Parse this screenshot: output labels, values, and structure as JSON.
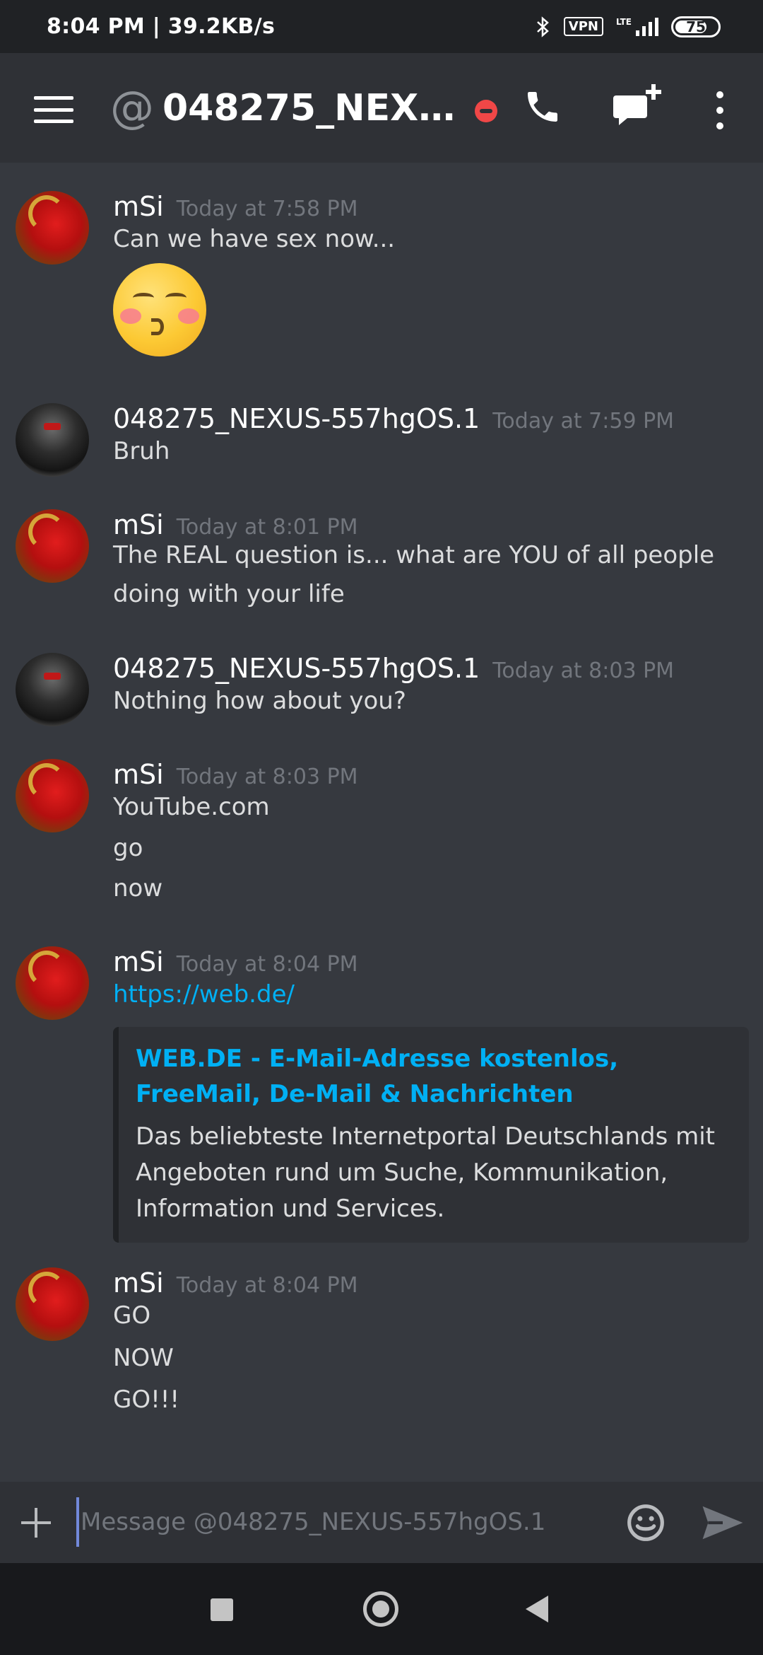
{
  "status_bar": {
    "time_speed": "8:04 PM | 39.2KB/s",
    "vpn_label": "VPN",
    "network_label": "LTE",
    "battery_level": "75",
    "battery_fraction": 0.75
  },
  "header": {
    "channel_prefix": "@",
    "channel_title": "048275_NEXUS...",
    "recipient_status": "do-not-disturb",
    "status_color": "#f04747"
  },
  "messages": [
    {
      "author": "mSi",
      "avatar": "red-dragon-avatar",
      "timestamp": "Today at 7:58 PM",
      "lines": [
        "Can we have sex now..."
      ],
      "emoji": "kissing-closed-eyes-emoji"
    },
    {
      "author": "048275_NEXUS-557hgOS.1",
      "avatar": "soldier-avatar",
      "timestamp": "Today at 7:59 PM",
      "lines": [
        "Bruh"
      ]
    },
    {
      "author": "mSi",
      "avatar": "red-dragon-avatar",
      "timestamp": "Today at 8:01 PM",
      "text": "The REAL question is... what are YOU of all people doing with your life"
    },
    {
      "author": "048275_NEXUS-557hgOS.1",
      "avatar": "soldier-avatar",
      "timestamp": "Today at 8:03 PM",
      "lines": [
        "Nothing how about you?"
      ]
    },
    {
      "author": "mSi",
      "avatar": "red-dragon-avatar",
      "timestamp": "Today at 8:03 PM",
      "lines": [
        "YouTube.com",
        "go",
        "now"
      ]
    },
    {
      "author": "mSi",
      "avatar": "red-dragon-avatar",
      "timestamp": "Today at 8:04 PM",
      "link": "https://web.de/",
      "embed": {
        "title": "WEB.DE - E-Mail-Adresse kostenlos, FreeMail, De-Mail & Nachrichten",
        "description": "Das beliebteste Internetportal Deutschlands mit Angeboten rund um Suche, Kommunikation, Information und Services."
      }
    },
    {
      "author": "mSi",
      "avatar": "red-dragon-avatar",
      "timestamp": "Today at 8:04 PM",
      "lines": [
        "GO",
        "NOW",
        "GO!!!"
      ]
    }
  ],
  "composer": {
    "placeholder": "Message @048275_NEXUS-557hgOS.1",
    "value": ""
  },
  "colors": {
    "background": "#36393f",
    "header": "#2f3136",
    "link": "#00b0f4",
    "timestamp": "#72767d"
  }
}
